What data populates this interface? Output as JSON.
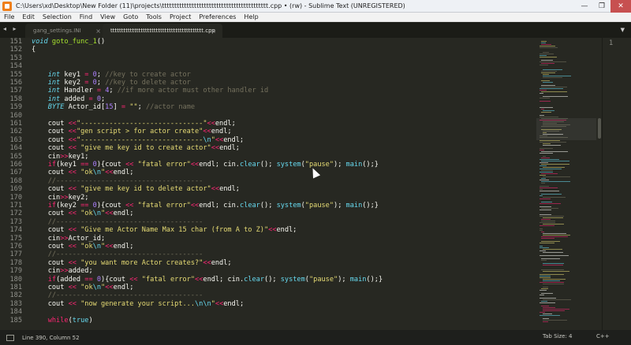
{
  "window": {
    "title": "C:\\Users\\xd\\Desktop\\New Folder (11)\\projects\\ttttttttttttttttttttttttttttttttttttttttttt.cpp • (rw) - Sublime Text (UNREGISTERED)",
    "minimize": "—",
    "maximize": "❐",
    "close": "✕"
  },
  "menu": [
    "File",
    "Edit",
    "Selection",
    "Find",
    "View",
    "Goto",
    "Tools",
    "Project",
    "Preferences",
    "Help"
  ],
  "tabs": {
    "nav": "◂ ▸",
    "items": [
      {
        "label": "gang_settings.INI",
        "close": "×",
        "active": false
      },
      {
        "label": "ttttttttttttttttttttttttttttttttttttttttttt.cpp",
        "close": "×",
        "active": true
      }
    ],
    "dropdown": "▼"
  },
  "editor": {
    "lines": [
      {
        "n": "151",
        "tokens": [
          {
            "c": "ty",
            "t": "void"
          },
          {
            "c": "",
            "t": " "
          },
          {
            "c": "fn",
            "t": "goto_func_1"
          },
          {
            "c": "",
            "t": "()"
          }
        ]
      },
      {
        "n": "152",
        "tokens": [
          {
            "c": "",
            "t": "{"
          }
        ]
      },
      {
        "n": "153",
        "tokens": []
      },
      {
        "n": "154",
        "tokens": []
      },
      {
        "n": "155",
        "tokens": [
          {
            "c": "",
            "t": "    "
          },
          {
            "c": "ty",
            "t": "int"
          },
          {
            "c": "",
            "t": " key1 "
          },
          {
            "c": "kw",
            "t": "="
          },
          {
            "c": "",
            "t": " "
          },
          {
            "c": "num",
            "t": "0"
          },
          {
            "c": "",
            "t": "; "
          },
          {
            "c": "cm",
            "t": "//key to create actor"
          }
        ]
      },
      {
        "n": "156",
        "tokens": [
          {
            "c": "",
            "t": "    "
          },
          {
            "c": "ty",
            "t": "int"
          },
          {
            "c": "",
            "t": " key2 "
          },
          {
            "c": "kw",
            "t": "="
          },
          {
            "c": "",
            "t": " "
          },
          {
            "c": "num",
            "t": "0"
          },
          {
            "c": "",
            "t": "; "
          },
          {
            "c": "cm",
            "t": "//key to delete actor"
          }
        ]
      },
      {
        "n": "157",
        "tokens": [
          {
            "c": "",
            "t": "    "
          },
          {
            "c": "ty",
            "t": "int"
          },
          {
            "c": "",
            "t": " Handler "
          },
          {
            "c": "kw",
            "t": "="
          },
          {
            "c": "",
            "t": " "
          },
          {
            "c": "num",
            "t": "4"
          },
          {
            "c": "",
            "t": "; "
          },
          {
            "c": "cm",
            "t": "//if more actor must other handler id"
          }
        ]
      },
      {
        "n": "158",
        "tokens": [
          {
            "c": "",
            "t": "    "
          },
          {
            "c": "ty",
            "t": "int"
          },
          {
            "c": "",
            "t": " added "
          },
          {
            "c": "kw",
            "t": "="
          },
          {
            "c": "",
            "t": " "
          },
          {
            "c": "num",
            "t": "0"
          },
          {
            "c": "",
            "t": ";"
          }
        ]
      },
      {
        "n": "159",
        "tokens": [
          {
            "c": "",
            "t": "    "
          },
          {
            "c": "ty",
            "t": "BYTE"
          },
          {
            "c": "",
            "t": " Actor_id["
          },
          {
            "c": "num",
            "t": "15"
          },
          {
            "c": "",
            "t": "] "
          },
          {
            "c": "kw",
            "t": "="
          },
          {
            "c": "",
            "t": " "
          },
          {
            "c": "str",
            "t": "\"\""
          },
          {
            "c": "",
            "t": "; "
          },
          {
            "c": "cm",
            "t": "//actor name"
          }
        ]
      },
      {
        "n": "160",
        "tokens": []
      },
      {
        "n": "161",
        "tokens": [
          {
            "c": "",
            "t": "    cout "
          },
          {
            "c": "kw",
            "t": "<<"
          },
          {
            "c": "str",
            "t": "\"------------------------------\""
          },
          {
            "c": "kw",
            "t": "<<"
          },
          {
            "c": "",
            "t": "endl;"
          }
        ]
      },
      {
        "n": "162",
        "tokens": [
          {
            "c": "",
            "t": "    cout "
          },
          {
            "c": "kw",
            "t": "<<"
          },
          {
            "c": "str",
            "t": "\"gen script > for actor create\""
          },
          {
            "c": "kw",
            "t": "<<"
          },
          {
            "c": "",
            "t": "endl;"
          }
        ]
      },
      {
        "n": "163",
        "tokens": [
          {
            "c": "",
            "t": "    cout "
          },
          {
            "c": "kw",
            "t": "<<"
          },
          {
            "c": "str",
            "t": "\"------------------------------"
          },
          {
            "c": "cn",
            "t": "\\n"
          },
          {
            "c": "str",
            "t": "\""
          },
          {
            "c": "kw",
            "t": "<<"
          },
          {
            "c": "",
            "t": "endl;"
          }
        ]
      },
      {
        "n": "164",
        "tokens": [
          {
            "c": "",
            "t": "    cout "
          },
          {
            "c": "kw",
            "t": "<<"
          },
          {
            "c": "",
            "t": " "
          },
          {
            "c": "str",
            "t": "\"give me key id to create actor\""
          },
          {
            "c": "kw",
            "t": "<<"
          },
          {
            "c": "",
            "t": "endl;"
          }
        ]
      },
      {
        "n": "165",
        "tokens": [
          {
            "c": "",
            "t": "    cin"
          },
          {
            "c": "kw",
            "t": ">>"
          },
          {
            "c": "",
            "t": "key1;"
          }
        ]
      },
      {
        "n": "166",
        "tokens": [
          {
            "c": "",
            "t": "    "
          },
          {
            "c": "kw",
            "t": "if"
          },
          {
            "c": "",
            "t": "(key1 "
          },
          {
            "c": "kw",
            "t": "=="
          },
          {
            "c": "",
            "t": " "
          },
          {
            "c": "num",
            "t": "0"
          },
          {
            "c": "",
            "t": "){cout "
          },
          {
            "c": "kw",
            "t": "<<"
          },
          {
            "c": "",
            "t": " "
          },
          {
            "c": "str",
            "t": "\"fatal error\""
          },
          {
            "c": "kw",
            "t": "<<"
          },
          {
            "c": "",
            "t": "endl; cin."
          },
          {
            "c": "cn",
            "t": "clear"
          },
          {
            "c": "",
            "t": "(); "
          },
          {
            "c": "cn",
            "t": "system"
          },
          {
            "c": "",
            "t": "("
          },
          {
            "c": "str",
            "t": "\"pause\""
          },
          {
            "c": "",
            "t": "); "
          },
          {
            "c": "cn",
            "t": "main"
          },
          {
            "c": "",
            "t": "();}"
          }
        ]
      },
      {
        "n": "167",
        "tokens": [
          {
            "c": "",
            "t": "    cout "
          },
          {
            "c": "kw",
            "t": "<<"
          },
          {
            "c": "",
            "t": " "
          },
          {
            "c": "str",
            "t": "\"ok"
          },
          {
            "c": "cn",
            "t": "\\n"
          },
          {
            "c": "str",
            "t": "\""
          },
          {
            "c": "kw",
            "t": "<<"
          },
          {
            "c": "",
            "t": "endl;"
          }
        ]
      },
      {
        "n": "168",
        "tokens": [
          {
            "c": "",
            "t": "    "
          },
          {
            "c": "cm",
            "t": "//------------------------------------"
          }
        ]
      },
      {
        "n": "169",
        "tokens": [
          {
            "c": "",
            "t": "    cout "
          },
          {
            "c": "kw",
            "t": "<<"
          },
          {
            "c": "",
            "t": " "
          },
          {
            "c": "str",
            "t": "\"give me key id to delete actor\""
          },
          {
            "c": "kw",
            "t": "<<"
          },
          {
            "c": "",
            "t": "endl;"
          }
        ]
      },
      {
        "n": "170",
        "tokens": [
          {
            "c": "",
            "t": "    cin"
          },
          {
            "c": "kw",
            "t": ">>"
          },
          {
            "c": "",
            "t": "key2;"
          }
        ]
      },
      {
        "n": "171",
        "tokens": [
          {
            "c": "",
            "t": "    "
          },
          {
            "c": "kw",
            "t": "if"
          },
          {
            "c": "",
            "t": "(key2 "
          },
          {
            "c": "kw",
            "t": "=="
          },
          {
            "c": "",
            "t": " "
          },
          {
            "c": "num",
            "t": "0"
          },
          {
            "c": "",
            "t": "){cout "
          },
          {
            "c": "kw",
            "t": "<<"
          },
          {
            "c": "",
            "t": " "
          },
          {
            "c": "str",
            "t": "\"fatal error\""
          },
          {
            "c": "kw",
            "t": "<<"
          },
          {
            "c": "",
            "t": "endl; cin."
          },
          {
            "c": "cn",
            "t": "clear"
          },
          {
            "c": "",
            "t": "(); "
          },
          {
            "c": "cn",
            "t": "system"
          },
          {
            "c": "",
            "t": "("
          },
          {
            "c": "str",
            "t": "\"pause\""
          },
          {
            "c": "",
            "t": "); "
          },
          {
            "c": "cn",
            "t": "main"
          },
          {
            "c": "",
            "t": "();}"
          }
        ]
      },
      {
        "n": "172",
        "tokens": [
          {
            "c": "",
            "t": "    cout "
          },
          {
            "c": "kw",
            "t": "<<"
          },
          {
            "c": "",
            "t": " "
          },
          {
            "c": "str",
            "t": "\"ok"
          },
          {
            "c": "cn",
            "t": "\\n"
          },
          {
            "c": "str",
            "t": "\""
          },
          {
            "c": "kw",
            "t": "<<"
          },
          {
            "c": "",
            "t": "endl;"
          }
        ]
      },
      {
        "n": "173",
        "tokens": [
          {
            "c": "",
            "t": "    "
          },
          {
            "c": "cm",
            "t": "//------------------------------------"
          }
        ]
      },
      {
        "n": "174",
        "tokens": [
          {
            "c": "",
            "t": "    cout "
          },
          {
            "c": "kw",
            "t": "<<"
          },
          {
            "c": "",
            "t": " "
          },
          {
            "c": "str",
            "t": "\"Give me Actor Name Max 15 char (from A to Z)\""
          },
          {
            "c": "kw",
            "t": "<<"
          },
          {
            "c": "",
            "t": "endl;"
          }
        ]
      },
      {
        "n": "175",
        "tokens": [
          {
            "c": "",
            "t": "    cin"
          },
          {
            "c": "kw",
            "t": ">>"
          },
          {
            "c": "",
            "t": "Actor_id;"
          }
        ]
      },
      {
        "n": "176",
        "tokens": [
          {
            "c": "",
            "t": "    cout "
          },
          {
            "c": "kw",
            "t": "<<"
          },
          {
            "c": "",
            "t": " "
          },
          {
            "c": "str",
            "t": "\"ok"
          },
          {
            "c": "cn",
            "t": "\\n"
          },
          {
            "c": "str",
            "t": "\""
          },
          {
            "c": "kw",
            "t": "<<"
          },
          {
            "c": "",
            "t": "endl;"
          }
        ]
      },
      {
        "n": "177",
        "tokens": [
          {
            "c": "",
            "t": "    "
          },
          {
            "c": "cm",
            "t": "//------------------------------------"
          }
        ]
      },
      {
        "n": "178",
        "tokens": [
          {
            "c": "",
            "t": "    cout "
          },
          {
            "c": "kw",
            "t": "<<"
          },
          {
            "c": "",
            "t": " "
          },
          {
            "c": "str",
            "t": "\"you want more Actor creates?\""
          },
          {
            "c": "kw",
            "t": "<<"
          },
          {
            "c": "",
            "t": "endl;"
          }
        ]
      },
      {
        "n": "179",
        "tokens": [
          {
            "c": "",
            "t": "    cin"
          },
          {
            "c": "kw",
            "t": ">>"
          },
          {
            "c": "",
            "t": "added;"
          }
        ]
      },
      {
        "n": "180",
        "tokens": [
          {
            "c": "",
            "t": "    "
          },
          {
            "c": "kw",
            "t": "if"
          },
          {
            "c": "",
            "t": "(added "
          },
          {
            "c": "kw",
            "t": "=="
          },
          {
            "c": "",
            "t": " "
          },
          {
            "c": "num",
            "t": "0"
          },
          {
            "c": "",
            "t": "){cout "
          },
          {
            "c": "kw",
            "t": "<<"
          },
          {
            "c": "",
            "t": " "
          },
          {
            "c": "str",
            "t": "\"fatal error\""
          },
          {
            "c": "kw",
            "t": "<<"
          },
          {
            "c": "",
            "t": "endl; cin."
          },
          {
            "c": "cn",
            "t": "clear"
          },
          {
            "c": "",
            "t": "(); "
          },
          {
            "c": "cn",
            "t": "system"
          },
          {
            "c": "",
            "t": "("
          },
          {
            "c": "str",
            "t": "\"pause\""
          },
          {
            "c": "",
            "t": "); "
          },
          {
            "c": "cn",
            "t": "main"
          },
          {
            "c": "",
            "t": "();}"
          }
        ]
      },
      {
        "n": "181",
        "tokens": [
          {
            "c": "",
            "t": "    cout "
          },
          {
            "c": "kw",
            "t": "<<"
          },
          {
            "c": "",
            "t": " "
          },
          {
            "c": "str",
            "t": "\"ok"
          },
          {
            "c": "cn",
            "t": "\\n"
          },
          {
            "c": "str",
            "t": "\""
          },
          {
            "c": "kw",
            "t": "<<"
          },
          {
            "c": "",
            "t": "endl;"
          }
        ]
      },
      {
        "n": "182",
        "tokens": [
          {
            "c": "",
            "t": "    "
          },
          {
            "c": "cm",
            "t": "//------------------------------------"
          }
        ]
      },
      {
        "n": "183",
        "tokens": [
          {
            "c": "",
            "t": "    cout "
          },
          {
            "c": "kw",
            "t": "<<"
          },
          {
            "c": "",
            "t": " "
          },
          {
            "c": "str",
            "t": "\"now generate your script..."
          },
          {
            "c": "cn",
            "t": "\\n\\n"
          },
          {
            "c": "str",
            "t": "\""
          },
          {
            "c": "kw",
            "t": "<<"
          },
          {
            "c": "",
            "t": "endl;"
          }
        ]
      },
      {
        "n": "184",
        "tokens": []
      },
      {
        "n": "185",
        "tokens": [
          {
            "c": "",
            "t": "    "
          },
          {
            "c": "kw",
            "t": "while"
          },
          {
            "c": "",
            "t": "("
          },
          {
            "c": "cn",
            "t": "true"
          },
          {
            "c": "",
            "t": ")"
          }
        ]
      }
    ]
  },
  "right_group": {
    "line_number": "1"
  },
  "status": {
    "position": "Line 390, Column 52",
    "tab_size": "Tab Size: 4",
    "syntax": "C++"
  }
}
